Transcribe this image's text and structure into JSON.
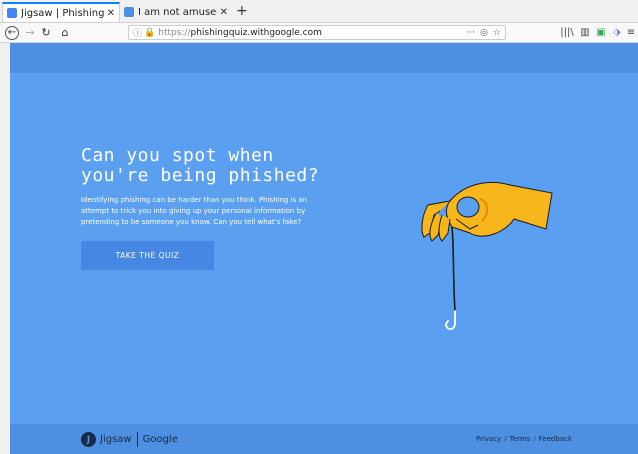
{
  "browser": {
    "tabs": [
      {
        "title": "Jigsaw | Phishing Quiz",
        "favicon_color": "#4285f4",
        "active": true
      },
      {
        "title": "I am not amused! (or how",
        "favicon_color": "#4a90e2",
        "active": false
      }
    ],
    "tab_close": "✕",
    "new_tab": "+",
    "url": {
      "protocol": "https://",
      "host": "phishingquiz.withgoogle.com"
    },
    "url_actions": {
      "more": "···",
      "pocket": "◎",
      "bookmark": "☆"
    },
    "nav": {
      "back": "←",
      "forward": "→",
      "reload": "↻",
      "home": "⌂"
    },
    "toolbar": {
      "library": "|||\\",
      "sidebar": "▥",
      "ext1": "▣",
      "ext2": "⬗",
      "menu": "≡"
    }
  },
  "page": {
    "headline": "Can you spot when you're being phished?",
    "intro": "Identifying phishing can be harder than you think. Phishing is an attempt to trick you into giving up your personal information by pretending to be someone you know. Can you tell what's fake?",
    "cta": "TAKE THE QUIZ",
    "colors": {
      "background": "#5b9ff0",
      "header_bar": "#4d8fe0",
      "button": "#4587e3",
      "hand": "#f7b61b"
    }
  },
  "footer": {
    "jigsaw": "Jigsaw",
    "google": "Google",
    "links": [
      "Privacy",
      "Terms",
      "Feedback"
    ],
    "separator": "/"
  }
}
